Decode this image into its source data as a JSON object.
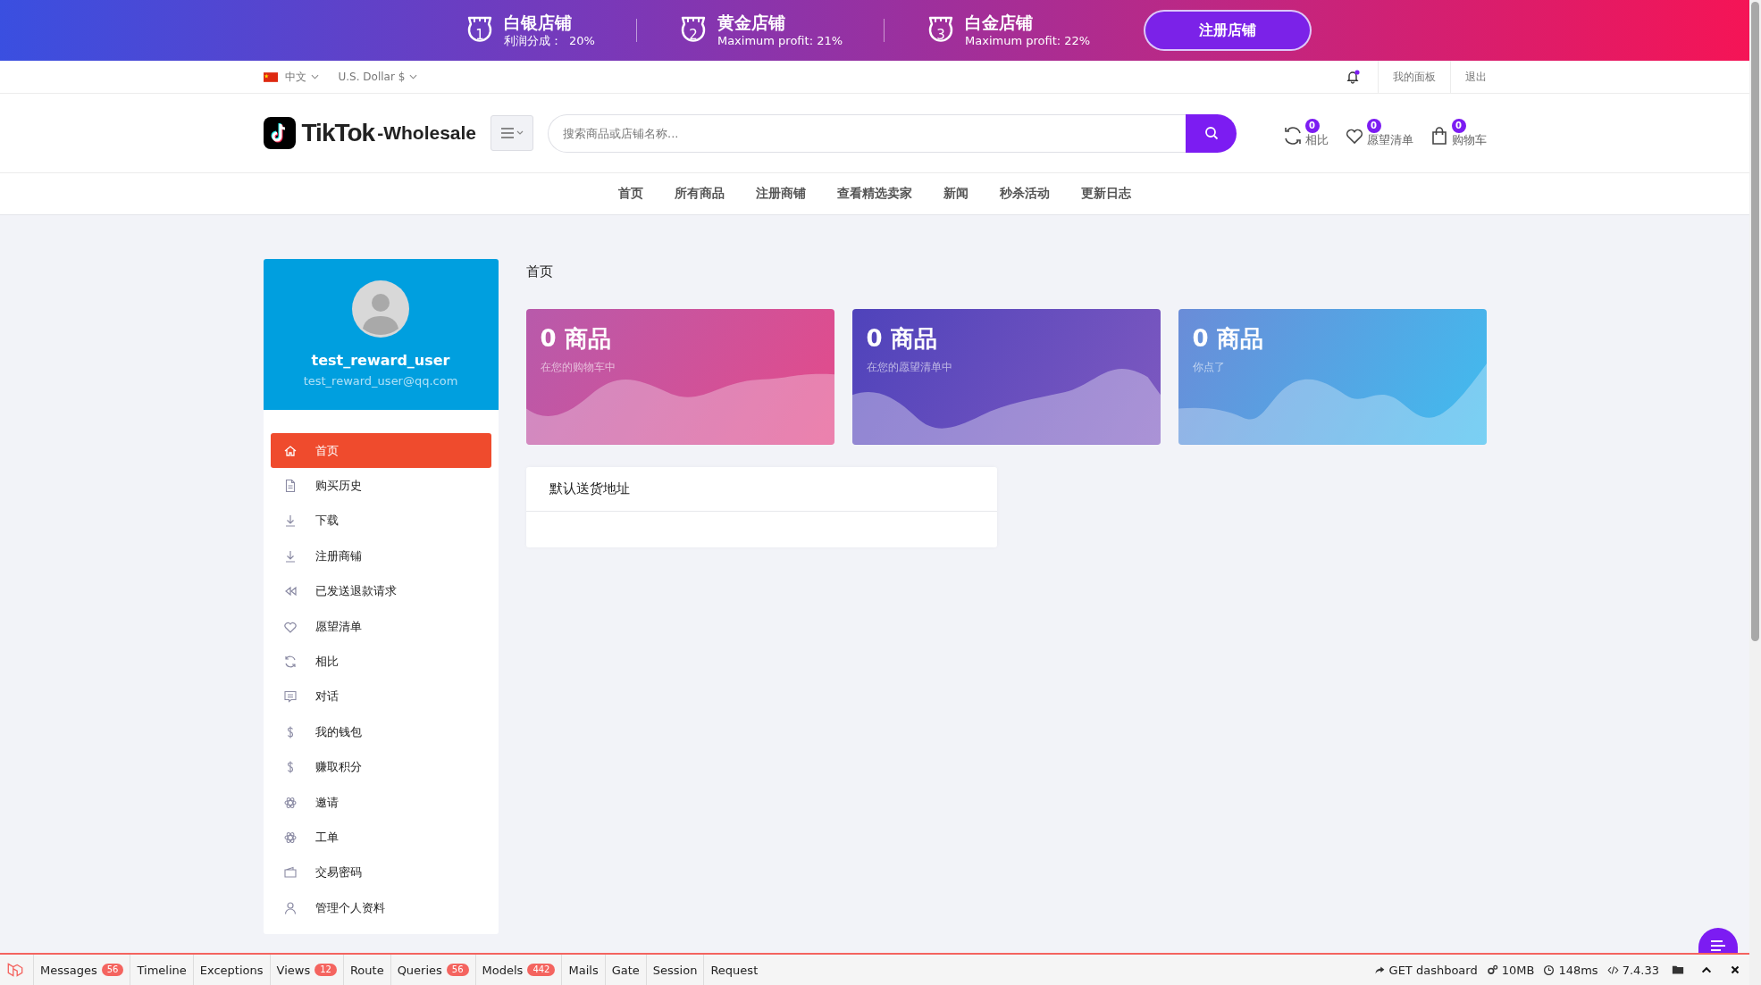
{
  "banner": {
    "tiers": [
      {
        "number": "1",
        "title": "白银店铺",
        "subtitle": "利润分成：  20%"
      },
      {
        "number": "2",
        "title": "黄金店铺",
        "subtitle": "Maximum profit: 21%"
      },
      {
        "number": "3",
        "title": "白金店铺",
        "subtitle": "Maximum profit: 22%"
      }
    ],
    "button": "注册店铺"
  },
  "topbar": {
    "language": "中文",
    "currency": "U.S. Dollar $",
    "notification": {
      "unread": true
    },
    "links": [
      "我的面板",
      "退出"
    ]
  },
  "header": {
    "logo": {
      "brand": "TikTok",
      "suffix": "-Wholesale"
    },
    "search": {
      "placeholder": "搜索商品或店铺名称..."
    },
    "actions": [
      {
        "kind": "compare",
        "count": "0",
        "label": "相比"
      },
      {
        "kind": "wishlist",
        "count": "0",
        "label": "愿望清单"
      },
      {
        "kind": "cart",
        "count": "0",
        "label": "购物车"
      }
    ]
  },
  "nav": {
    "items": [
      "首页",
      "所有商品",
      "注册商铺",
      "查看精选卖家",
      "新闻",
      "秒杀活动",
      "更新日志"
    ]
  },
  "profile": {
    "username": "test_reward_user",
    "email": "test_reward_user@qq.com"
  },
  "menu": {
    "items": [
      {
        "label": "首页",
        "selected": true
      },
      {
        "label": "购买历史",
        "selected": false
      },
      {
        "label": "下载",
        "selected": false
      },
      {
        "label": "注册商铺",
        "selected": false
      },
      {
        "label": "已发送退款请求",
        "selected": false
      },
      {
        "label": "愿望清单",
        "selected": false
      },
      {
        "label": "相比",
        "selected": false
      },
      {
        "label": "对话",
        "selected": false
      },
      {
        "label": "我的钱包",
        "selected": false
      },
      {
        "label": "赚取积分",
        "selected": false
      },
      {
        "label": "邀请",
        "selected": false
      },
      {
        "label": "工单",
        "selected": false
      },
      {
        "label": "交易密码",
        "selected": false
      },
      {
        "label": "管理个人资料",
        "selected": false
      }
    ]
  },
  "page_title": "首页",
  "stats": [
    {
      "kind": "cart",
      "count": "0 商品",
      "caption": "在您的购物车中"
    },
    {
      "kind": "wishlist",
      "count": "0 商品",
      "caption": "在您的愿望清单中"
    },
    {
      "kind": "clicks",
      "count": "0 商品",
      "caption": "你点了"
    }
  ],
  "address_card": {
    "title": "默认送货地址"
  },
  "debug_bar": {
    "tabs": [
      {
        "label": "Messages",
        "count": "56"
      },
      {
        "label": "Timeline"
      },
      {
        "label": "Exceptions"
      },
      {
        "label": "Views",
        "count": "12"
      },
      {
        "label": "Route"
      },
      {
        "label": "Queries",
        "count": "56"
      },
      {
        "label": "Models",
        "count": "442"
      },
      {
        "label": "Mails"
      },
      {
        "label": "Gate"
      },
      {
        "label": "Session"
      },
      {
        "label": "Request"
      }
    ],
    "stats": [
      {
        "kind": "route",
        "text": "GET dashboard"
      },
      {
        "kind": "memory",
        "text": "10MB"
      },
      {
        "kind": "time",
        "text": "148ms"
      },
      {
        "kind": "version",
        "text": "7.4.33"
      }
    ]
  }
}
